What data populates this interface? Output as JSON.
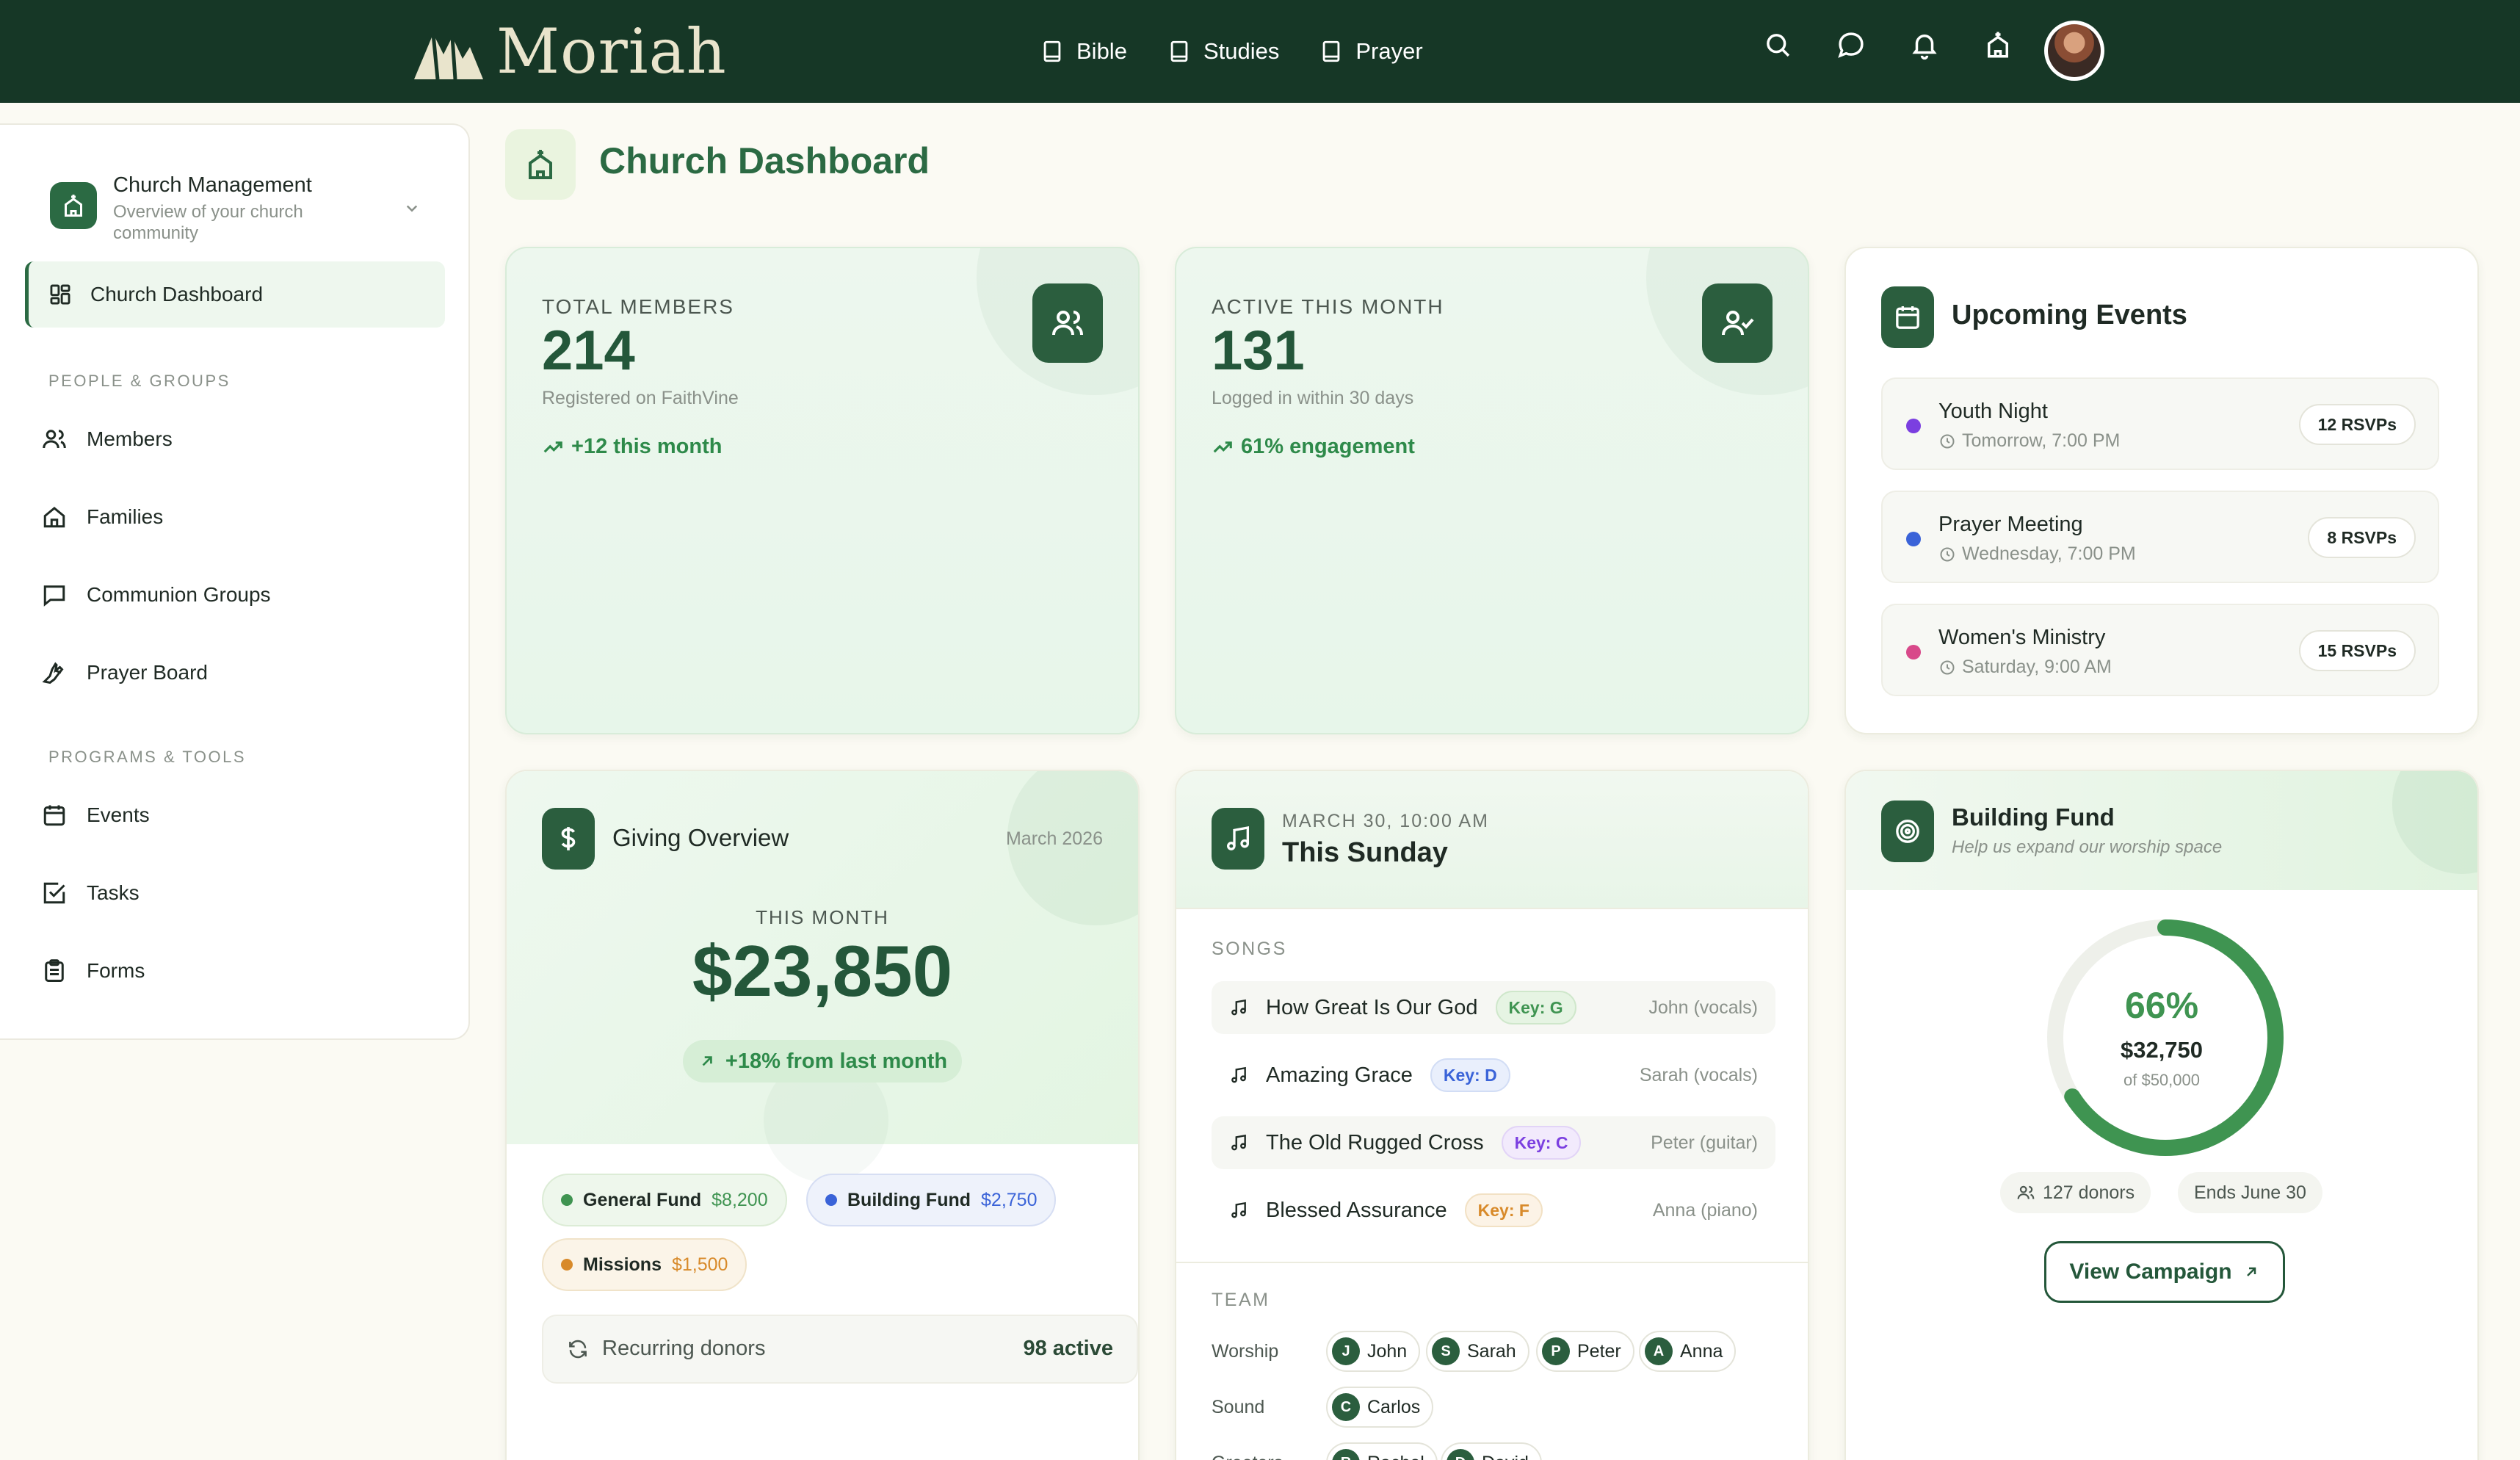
{
  "app": {
    "name": "Moriah"
  },
  "nav": {
    "items": [
      {
        "label": "Bible"
      },
      {
        "label": "Studies"
      },
      {
        "label": "Prayer"
      }
    ]
  },
  "sidebar": {
    "org_title": "Church Management",
    "org_subtitle": "Overview of your church community",
    "active_item": "Church Dashboard",
    "section_people": "PEOPLE & GROUPS",
    "people_items": [
      {
        "label": "Members"
      },
      {
        "label": "Families"
      },
      {
        "label": "Communion Groups"
      },
      {
        "label": "Prayer Board"
      }
    ],
    "section_programs": "PROGRAMS & TOOLS",
    "program_items": [
      {
        "label": "Events"
      },
      {
        "label": "Tasks"
      },
      {
        "label": "Forms"
      }
    ]
  },
  "page": {
    "title": "Church Dashboard"
  },
  "stats": {
    "members": {
      "label": "TOTAL MEMBERS",
      "value": "214",
      "sub": "Registered on FaithVine",
      "trend": "+12 this month"
    },
    "active": {
      "label": "ACTIVE THIS MONTH",
      "value": "131",
      "sub": "Logged in within 30 days",
      "trend": "61% engagement"
    }
  },
  "events": {
    "title": "Upcoming Events",
    "items": [
      {
        "name": "Youth Night",
        "time": "Tomorrow, 7:00 PM",
        "rsvp": "12 RSVPs",
        "color": "#7b3fe0"
      },
      {
        "name": "Prayer Meeting",
        "time": "Wednesday, 7:00 PM",
        "rsvp": "8 RSVPs",
        "color": "#3a63d8"
      },
      {
        "name": "Women's Ministry",
        "time": "Saturday, 9:00 AM",
        "rsvp": "15 RSVPs",
        "color": "#d8498a"
      }
    ]
  },
  "giving": {
    "title": "Giving Overview",
    "date": "March 2026",
    "label": "THIS MONTH",
    "amount": "$23,850",
    "trend": "+18% from last month",
    "funds": [
      {
        "name": "General Fund",
        "amount": "$8,200",
        "color": "#3f9451"
      },
      {
        "name": "Building Fund",
        "amount": "$2,750",
        "color": "#3a63d8"
      },
      {
        "name": "Missions",
        "amount": "$1,500",
        "color": "#d88a2a"
      }
    ],
    "recurring_label": "Recurring donors",
    "recurring_value": "98 active"
  },
  "sunday": {
    "date": "MARCH 30, 10:00 AM",
    "title": "This Sunday",
    "songs_label": "SONGS",
    "songs": [
      {
        "name": "How Great Is Our God",
        "key": "Key: G",
        "artist": "John (vocals)"
      },
      {
        "name": "Amazing Grace",
        "key": "Key: D",
        "artist": "Sarah (vocals)"
      },
      {
        "name": "The Old Rugged Cross",
        "key": "Key: C",
        "artist": "Peter (guitar)"
      },
      {
        "name": "Blessed Assurance",
        "key": "Key: F",
        "artist": "Anna (piano)"
      }
    ],
    "team_label": "TEAM",
    "team": [
      {
        "role": "Worship",
        "members": [
          {
            "initial": "J",
            "name": "John"
          },
          {
            "initial": "S",
            "name": "Sarah"
          },
          {
            "initial": "P",
            "name": "Peter"
          },
          {
            "initial": "A",
            "name": "Anna"
          }
        ]
      },
      {
        "role": "Sound",
        "members": [
          {
            "initial": "C",
            "name": "Carlos"
          }
        ]
      },
      {
        "role": "Greeters",
        "members": [
          {
            "initial": "R",
            "name": "Rachel"
          },
          {
            "initial": "D",
            "name": "David"
          }
        ]
      }
    ]
  },
  "building_fund": {
    "title": "Building Fund",
    "subtitle": "Help us expand our worship space",
    "percent": "66%",
    "progress": 0.66,
    "raised": "$32,750",
    "goal": "of $50,000",
    "donors": "127 donors",
    "ends": "Ends June 30",
    "button": "View Campaign"
  },
  "colors": {
    "primary": "#24573a",
    "topbar": "#163726",
    "accent": "#3f9451"
  }
}
